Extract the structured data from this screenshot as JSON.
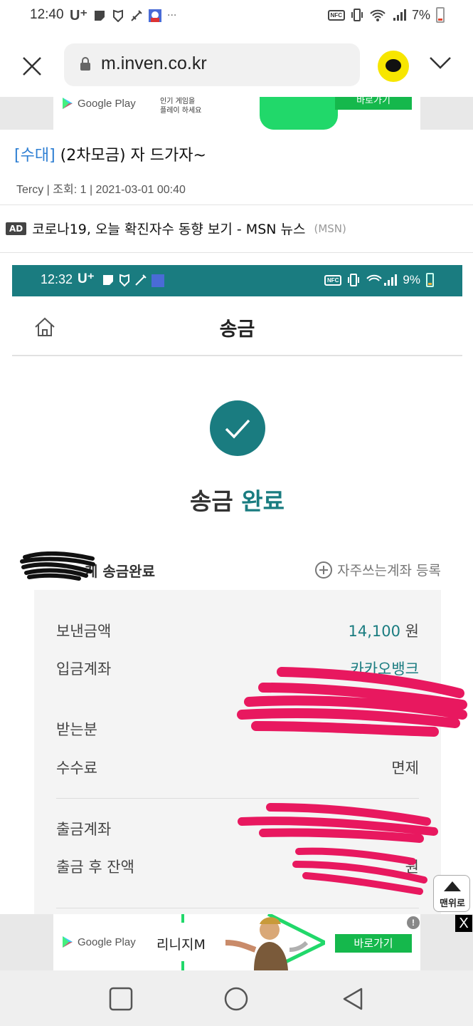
{
  "status_bar": {
    "time": "12:40",
    "carrier": "U⁺",
    "battery_percent": "7%",
    "nfc_label": "NFC"
  },
  "browser": {
    "url": "m.inven.co.kr"
  },
  "top_ad": {
    "store": "Google Play",
    "copy_line1": "인기 게임을",
    "copy_line2": "플레이 하세요",
    "cta": "바로가기"
  },
  "post": {
    "category": "[수대]",
    "title": "(2차모금) 자 드가자~",
    "meta": "Tercy | 조회: 1 | 2021-03-01 00:40"
  },
  "native_ad": {
    "badge": "AD",
    "text": "코로나19, 오늘 확진자수 동향 보기 - MSN 뉴스",
    "source": "(MSN)"
  },
  "screenshot": {
    "status_bar": {
      "time": "12:32",
      "carrier": "U⁺",
      "battery_percent": "9%",
      "nfc_label": "NFC"
    },
    "header_title": "송금",
    "done_text_part1": "송금",
    "done_text_part2": "완료",
    "recipient_suffix": "게 송금완료",
    "favorite_link": "자주쓰는계좌 등록",
    "rows": [
      {
        "label": "보낸금액",
        "value": "14,100",
        "unit": "원"
      },
      {
        "label": "입금계좌",
        "value": "카카오뱅크"
      },
      {
        "label": "받는분",
        "value": ""
      },
      {
        "label": "수수료",
        "value": "면제"
      },
      {
        "label": "출금계좌",
        "value": ""
      },
      {
        "label": "출금 후 잔액",
        "value": "원"
      }
    ]
  },
  "scroll_top": {
    "label": "맨위로"
  },
  "bottom_ad": {
    "store": "Google Play",
    "game": "리니지M",
    "cta": "바로가기",
    "close": "X",
    "info": "!"
  },
  "colors": {
    "teal": "#1a7c80",
    "redact": "#e8185f",
    "link_blue": "#2e7fd3",
    "ad_green": "#15b84c"
  }
}
